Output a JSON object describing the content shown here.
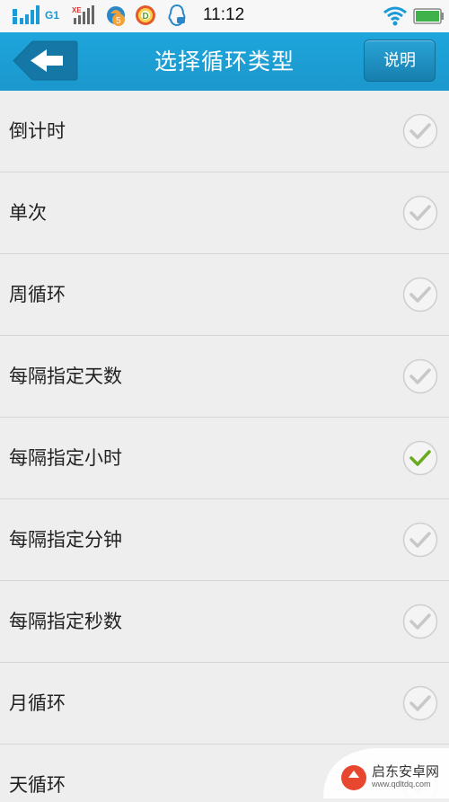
{
  "status_bar": {
    "time": "11:12",
    "carrier_tag": "G1",
    "icons": [
      "signal-1-icon",
      "signal-2-icon",
      "notification-5-icon",
      "browser-icon",
      "qq-icon",
      "wifi-icon",
      "battery-icon"
    ]
  },
  "header": {
    "title": "选择循环类型",
    "help_label": "说明",
    "back_icon": "back-arrow-icon",
    "color": "#1ea6dc"
  },
  "options": [
    {
      "label": "倒计时",
      "selected": false
    },
    {
      "label": "单次",
      "selected": false
    },
    {
      "label": "周循环",
      "selected": false
    },
    {
      "label": "每隔指定天数",
      "selected": false
    },
    {
      "label": "每隔指定小时",
      "selected": true
    },
    {
      "label": "每隔指定分钟",
      "selected": false
    },
    {
      "label": "每隔指定秒数",
      "selected": false
    },
    {
      "label": "月循环",
      "selected": false
    },
    {
      "label": "天循环",
      "selected": false
    }
  ],
  "colors": {
    "check_selected": "#6aaa1e",
    "check_unselected": "#c8c8c8"
  },
  "watermark": {
    "title": "启东安卓网",
    "url": "www.qdltdq.com"
  }
}
